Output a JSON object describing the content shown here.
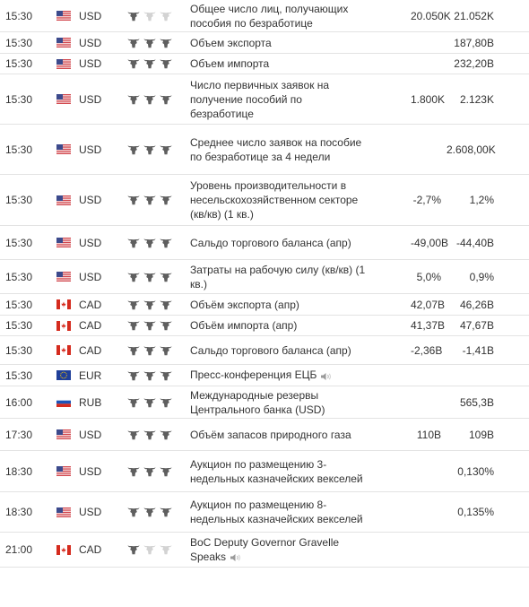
{
  "colors": {
    "bull_active": "#5f5f5f",
    "bull_inactive": "#d3d3d3",
    "row_border": "#e3e3e3"
  },
  "rows": [
    {
      "time": "15:30",
      "flag": "us",
      "currency": "USD",
      "importance": 1,
      "event": "Общее число лиц, получающих пособия по безработице",
      "actual": "",
      "forecast": "20.050K",
      "previous": "21.052K",
      "speaker": false
    },
    {
      "time": "15:30",
      "flag": "us",
      "currency": "USD",
      "importance": 3,
      "event": "Объем экспорта",
      "actual": "",
      "forecast": "",
      "previous": "187,80B",
      "speaker": false
    },
    {
      "time": "15:30",
      "flag": "us",
      "currency": "USD",
      "importance": 3,
      "event": "Объем импорта",
      "actual": "",
      "forecast": "",
      "previous": "232,20B",
      "speaker": false
    },
    {
      "time": "15:30",
      "flag": "us",
      "currency": "USD",
      "importance": 3,
      "event": "Число первичных заявок на получение пособий по безработице",
      "actual": "",
      "forecast": "1.800K",
      "previous": "2.123K",
      "speaker": false
    },
    {
      "time": "15:30",
      "flag": "us",
      "currency": "USD",
      "importance": 3,
      "event": "Среднее число заявок на пособие по безработице за 4 недели",
      "actual": "",
      "forecast": "",
      "previous": "2.608,00K",
      "speaker": false
    },
    {
      "time": "15:30",
      "flag": "us",
      "currency": "USD",
      "importance": 3,
      "event": "Уровень производительности в несельскохозяйственном секторе (кв/кв) (1 кв.)",
      "actual": "",
      "forecast": "-2,7%",
      "previous": "1,2%",
      "speaker": false
    },
    {
      "time": "15:30",
      "flag": "us",
      "currency": "USD",
      "importance": 3,
      "event": "Сальдо торгового баланса (апр)",
      "actual": "",
      "forecast": "-49,00B",
      "previous": "-44,40B",
      "speaker": false
    },
    {
      "time": "15:30",
      "flag": "us",
      "currency": "USD",
      "importance": 3,
      "event": "Затраты на рабочую силу (кв/кв) (1 кв.)",
      "actual": "",
      "forecast": "5,0%",
      "previous": "0,9%",
      "speaker": false
    },
    {
      "time": "15:30",
      "flag": "ca",
      "currency": "CAD",
      "importance": 3,
      "event": "Объём экспорта (апр)",
      "actual": "",
      "forecast": "42,07B",
      "previous": "46,26B",
      "speaker": false
    },
    {
      "time": "15:30",
      "flag": "ca",
      "currency": "CAD",
      "importance": 3,
      "event": "Объём импорта (апр)",
      "actual": "",
      "forecast": "41,37B",
      "previous": "47,67B",
      "speaker": false
    },
    {
      "time": "15:30",
      "flag": "ca",
      "currency": "CAD",
      "importance": 3,
      "event": "Сальдо торгового баланса (апр)",
      "actual": "",
      "forecast": "-2,36B",
      "previous": "-1,41B",
      "speaker": false
    },
    {
      "time": "15:30",
      "flag": "eu",
      "currency": "EUR",
      "importance": 3,
      "event": "Пресс-конференция ЕЦБ",
      "actual": "",
      "forecast": "",
      "previous": "",
      "speaker": true
    },
    {
      "time": "16:00",
      "flag": "ru",
      "currency": "RUB",
      "importance": 3,
      "event": "Международные резервы Центрального банка (USD)",
      "actual": "",
      "forecast": "",
      "previous": "565,3B",
      "speaker": false
    },
    {
      "time": "17:30",
      "flag": "us",
      "currency": "USD",
      "importance": 3,
      "event": "Объём запасов природного газа",
      "actual": "",
      "forecast": "110B",
      "previous": "109B",
      "speaker": false
    },
    {
      "time": "18:30",
      "flag": "us",
      "currency": "USD",
      "importance": 3,
      "event": "Аукцион по размещению 3-недельных казначейских векселей",
      "actual": "",
      "forecast": "",
      "previous": "0,130%",
      "speaker": false
    },
    {
      "time": "18:30",
      "flag": "us",
      "currency": "USD",
      "importance": 3,
      "event": "Аукцион по размещению 8-недельных казначейских векселей",
      "actual": "",
      "forecast": "",
      "previous": "0,135%",
      "speaker": false
    },
    {
      "time": "21:00",
      "flag": "ca",
      "currency": "CAD",
      "importance": 1,
      "event": "BoC Deputy Governor Gravelle Speaks",
      "actual": "",
      "forecast": "",
      "previous": "",
      "speaker": true
    }
  ]
}
